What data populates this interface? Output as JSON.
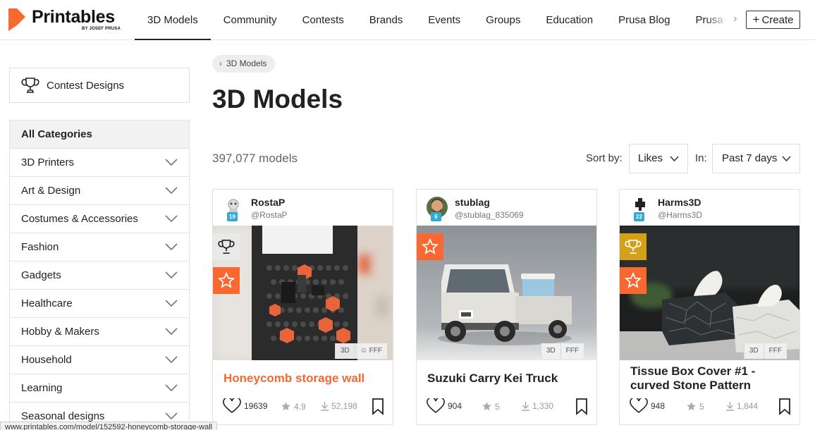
{
  "brand": {
    "name": "Printables",
    "sub": "by JOSEF PRUSA",
    "color": "#fa6831"
  },
  "nav": {
    "items": [
      {
        "label": "3D Models",
        "active": true
      },
      {
        "label": "Community"
      },
      {
        "label": "Contests"
      },
      {
        "label": "Brands"
      },
      {
        "label": "Events"
      },
      {
        "label": "Groups"
      },
      {
        "label": "Education"
      },
      {
        "label": "Prusa Blog"
      },
      {
        "label": "Prusa"
      }
    ],
    "create_label": "Create"
  },
  "sidebar": {
    "contest_label": "Contest Designs",
    "all_categories": "All Categories",
    "categories": [
      "3D Printers",
      "Art & Design",
      "Costumes & Accessories",
      "Fashion",
      "Gadgets",
      "Healthcare",
      "Hobby & Makers",
      "Household",
      "Learning",
      "Seasonal designs"
    ]
  },
  "main": {
    "breadcrumb": "3D Models",
    "title": "3D Models",
    "count": "397,077 models",
    "sort_label": "Sort by:",
    "sort_value": "Likes",
    "in_label": "In:",
    "in_value": "Past 7 days"
  },
  "cards": [
    {
      "user": "RostaP",
      "handle": "@RostaP",
      "level": "19",
      "title": "Honeycomb storage wall",
      "title_highlight": true,
      "tags": [
        "3D",
        "FFF"
      ],
      "contest": true,
      "featured": true,
      "likes": "19639",
      "rating": "4.9",
      "downloads": "52,198"
    },
    {
      "user": "stublag",
      "handle": "@stublag_835069",
      "level": "6",
      "title": "Suzuki Carry Kei Truck",
      "title_highlight": false,
      "tags": [
        "3D",
        "FFF"
      ],
      "contest": false,
      "featured": true,
      "likes": "904",
      "rating": "5",
      "downloads": "1,330"
    },
    {
      "user": "Harms3D",
      "handle": "@Harms3D",
      "level": "22",
      "title": "Tissue Box Cover #1 - curved Stone Pattern",
      "title_highlight": false,
      "tags": [
        "3D",
        "FFF"
      ],
      "contest": true,
      "featured": true,
      "likes": "948",
      "rating": "5",
      "downloads": "1,844"
    }
  ],
  "status_url": "www.printables.com/model/152592-honeycomb-storage-wall"
}
